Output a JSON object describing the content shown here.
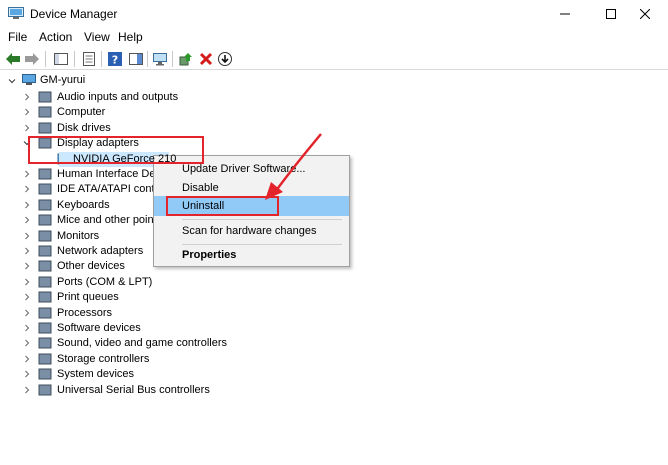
{
  "window": {
    "title": "Device Manager"
  },
  "menubar": {
    "items": [
      "File",
      "Action",
      "View",
      "Help"
    ]
  },
  "tree": {
    "root": "GM-yurui",
    "categories": [
      "Audio inputs and outputs",
      "Computer",
      "Disk drives",
      "Display adapters",
      "Human Interface Dev",
      "IDE ATA/ATAPI contro",
      "Keyboards",
      "Mice and other poin",
      "Monitors",
      "Network adapters",
      "Other devices",
      "Ports (COM & LPT)",
      "Print queues",
      "Processors",
      "Software devices",
      "Sound, video and game controllers",
      "Storage controllers",
      "System devices",
      "Universal Serial Bus controllers"
    ],
    "display_child": "NVIDIA GeForce 210"
  },
  "context_menu": {
    "items": [
      "Update Driver Software...",
      "Disable",
      "Uninstall",
      "Scan for hardware changes",
      "Properties"
    ]
  },
  "colors": {
    "annotation": "#e3242b",
    "selection": "#cce8ff",
    "menu_highlight": "#91c9f7"
  }
}
